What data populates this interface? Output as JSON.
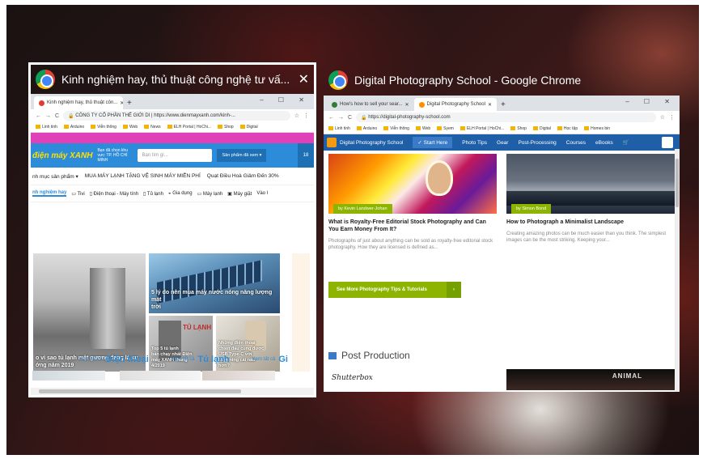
{
  "window1": {
    "title": "Kinh nghiệm hay, thủ thuật công nghệ tư vấ...",
    "close": "✕",
    "tab_label": "Kinh nghiệm hay, thủ thuật côn...",
    "new_tab": "+",
    "window_controls": "– ☐ ✕",
    "url": "CÔNG TY CỔ PHẦN THẾ GIỚI DI | https://www.dienmayxanh.com/kinh-...",
    "bookmarks": [
      "Linh tinh",
      "Arduino",
      "Viễn thông",
      "Web",
      "News",
      "ELH Portal | HoChi...",
      "Shop",
      "Digital"
    ],
    "site": {
      "logo": "điện máy XANH",
      "location": "Bạn đã chọn khu vực: TP. HỒ CHÍ MINH",
      "search_placeholder": "Bạn tìm gì...",
      "products_btn": "Sản phẩm đã xem ▾",
      "right_btn": "18",
      "menu1": [
        "nh mục sản phẩm ▾",
        "MUA MÁY LẠNH TẶNG VỆ SINH MÁY MIỄN PHÍ",
        "Quạt Điều Hoà Giảm Đến 30%"
      ],
      "menu2": [
        "nh nghiệm hay",
        "Tivi",
        "Điện thoại - Máy tính",
        "Tủ lạnh",
        "Gia dụng",
        "Máy lạnh",
        "Máy giặt",
        "Vào l"
      ],
      "articles": [
        "o vì sao tủ lạnh mặt gương đang là xu\nớng năm 2019",
        "5 lý do nên mua máy nước nóng năng lượng mặt\ntrời",
        "Top 5 tủ lạnh\nbán chạy nhất Điện\nmáy XANH tháng\n4/2019",
        "Top 5 tủ lạnh\nbán chạy nhất",
        "Những điện thoại\nchiến đấu cùng được\nUSB Type-C với\nLightning cái nào\nhơn?"
      ],
      "fridge_sign": "TỦ LẠNH",
      "sections": [
        {
          "more": "Xem tất cả",
          "name": "Điện thoại"
        },
        {
          "more": "Xem tất cả",
          "name": "Tủ lạnh"
        },
        {
          "more": "Xem tất cả",
          "name": "Gi"
        }
      ]
    }
  },
  "window2": {
    "title": "Digital Photography School - Google Chrome",
    "tabs": [
      "How's how to sell your sear...",
      "Digital Photography School"
    ],
    "new_tab": "+",
    "window_controls": "– ☐ ✕",
    "url": "https://digital-photography-school.com",
    "bookmarks": [
      "Linh tinh",
      "Arduino",
      "Viễn thông",
      "Web",
      "Syem",
      "ELH Portal | HoChi...",
      "Shop",
      "Digital",
      "Học tập",
      "Homes bin"
    ],
    "nav": {
      "logo": "Digital Photography School",
      "start": "✓ Start Here",
      "items": [
        "Photo Tips",
        "Gear",
        "Post-Processing",
        "Courses",
        "eBooks",
        "🛒"
      ]
    },
    "articles": [
      {
        "byline": "by Kevin Landwer-Johan",
        "title": "What is Royalty-Free Editorial Stock Photography and Can You Earn Money From It?",
        "excerpt": "Photographs of just about anything can be sold as royalty-free editorial stock photography. How they are licensed is defined as..."
      },
      {
        "byline": "by Simon Bond",
        "title": "How to Photograph a Minimalist Landscape",
        "excerpt": "Creating amazing photos can be much easier than you think. The simplest images can be the most striking. Keeping your..."
      }
    ],
    "more_button": "See More Photography Tips & Tutorials",
    "more_arrow": "›",
    "section_title": "Post Production",
    "brand_logo": "Shutterbox",
    "animal_sign": "ANIMAL"
  },
  "colors": {
    "dmx_blue": "#2d8cd9",
    "dps_blue": "#1e5fa8",
    "dps_green": "#8cb400",
    "magenta": "#e040b8"
  }
}
